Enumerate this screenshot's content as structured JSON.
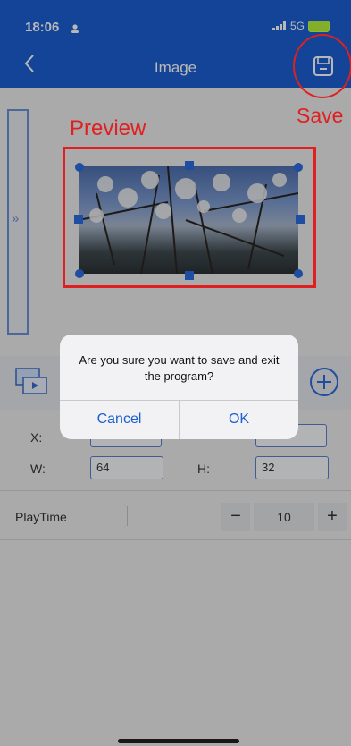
{
  "status": {
    "time": "18:06",
    "network": "5G"
  },
  "header": {
    "title": "Image",
    "back_icon": "chevron-left-icon",
    "save_icon": "save-icon"
  },
  "annotations": {
    "save": "Save",
    "preview": "Preview",
    "color": "#e02020"
  },
  "sidebar": {
    "expand_icon": "double-chevron-right-icon",
    "text": "»"
  },
  "fields": {
    "x_label": "X:",
    "x_value": "",
    "y_value": "",
    "w_label": "W:",
    "w_value": "64",
    "h_label": "H:",
    "h_value": "32"
  },
  "playtime": {
    "label": "PlayTime",
    "minus": "−",
    "value": "10",
    "plus": "+"
  },
  "dialog": {
    "message": "Are you sure you want to save and exit the program?",
    "cancel": "Cancel",
    "ok": "OK"
  },
  "colors": {
    "brand": "#1b5fd2",
    "accent": "#2b6be0"
  }
}
